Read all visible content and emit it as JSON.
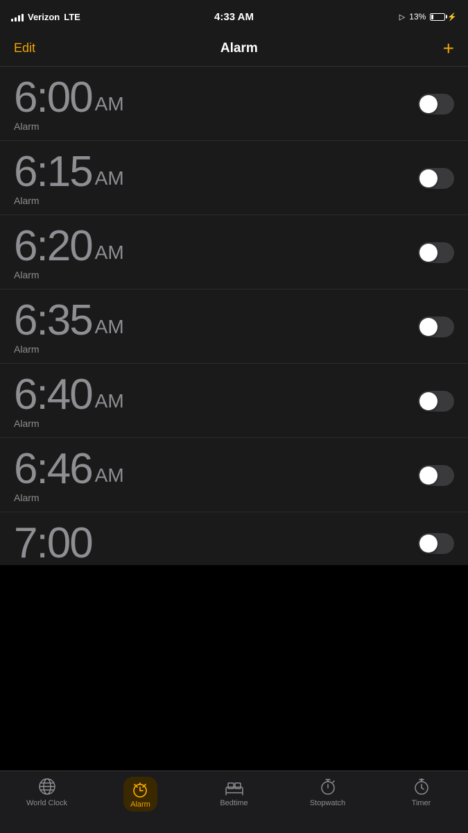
{
  "status": {
    "carrier": "Verizon",
    "network": "LTE",
    "time": "4:33 AM",
    "location_icon": "▲",
    "battery_percent": "13%",
    "battery_charging": true
  },
  "header": {
    "edit_label": "Edit",
    "title": "Alarm",
    "add_label": "+"
  },
  "alarms": [
    {
      "time": "6:00",
      "ampm": "AM",
      "label": "Alarm",
      "enabled": false
    },
    {
      "time": "6:15",
      "ampm": "AM",
      "label": "Alarm",
      "enabled": false
    },
    {
      "time": "6:20",
      "ampm": "AM",
      "label": "Alarm",
      "enabled": false
    },
    {
      "time": "6:35",
      "ampm": "AM",
      "label": "Alarm",
      "enabled": false
    },
    {
      "time": "6:40",
      "ampm": "AM",
      "label": "Alarm",
      "enabled": false
    },
    {
      "time": "6:46",
      "ampm": "AM",
      "label": "Alarm",
      "enabled": false
    }
  ],
  "partial_alarm": {
    "time": "7:00"
  },
  "tabs": [
    {
      "id": "world-clock",
      "label": "World Clock",
      "icon": "🌐",
      "active": false
    },
    {
      "id": "alarm",
      "label": "Alarm",
      "icon": "⏰",
      "active": true
    },
    {
      "id": "bedtime",
      "label": "Bedtime",
      "icon": "🛏",
      "active": false
    },
    {
      "id": "stopwatch",
      "label": "Stopwatch",
      "icon": "⏱",
      "active": false
    },
    {
      "id": "timer",
      "label": "Timer",
      "icon": "⏲",
      "active": false
    }
  ]
}
